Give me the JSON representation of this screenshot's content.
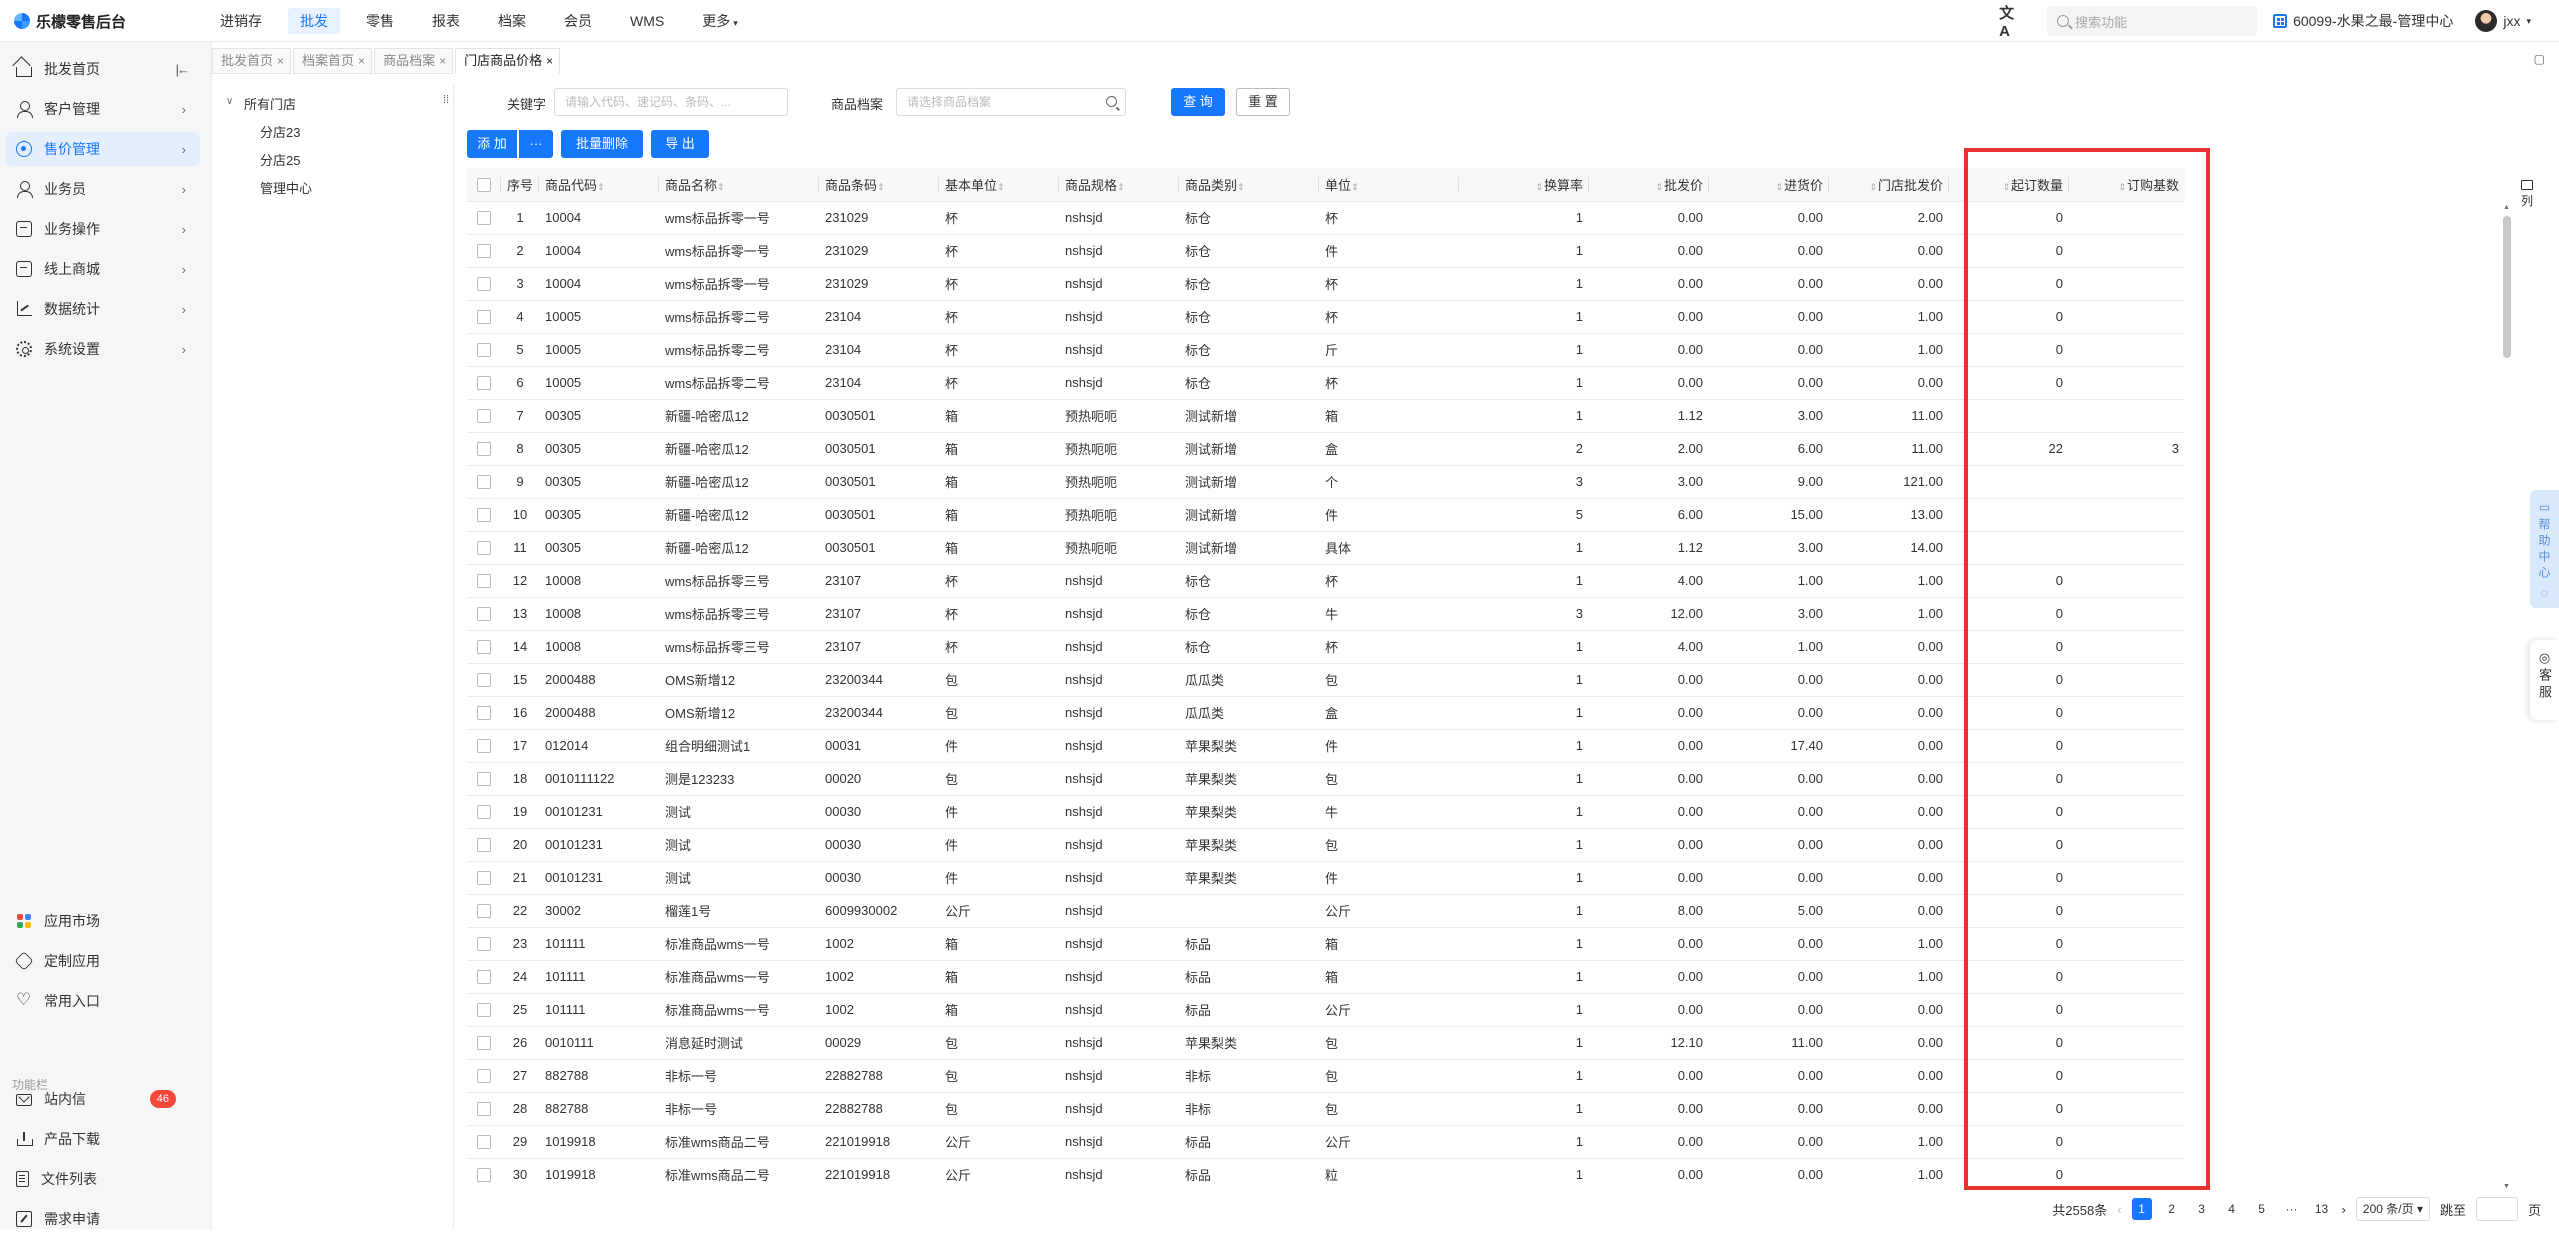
{
  "app": {
    "title": "乐檬零售后台"
  },
  "topnav": {
    "items": [
      {
        "label": "进销存"
      },
      {
        "label": "批发"
      },
      {
        "label": "零售"
      },
      {
        "label": "报表"
      },
      {
        "label": "档案"
      },
      {
        "label": "会员"
      },
      {
        "label": "WMS"
      },
      {
        "label": "更多"
      }
    ],
    "active": "批发",
    "search_placeholder": "搜索功能",
    "store": "60099-水果之最-管理中心",
    "user": "jxx"
  },
  "sidebar": {
    "items": [
      {
        "label": "批发首页",
        "icon": "home-icon"
      },
      {
        "label": "客户管理",
        "icon": "user-icon"
      },
      {
        "label": "售价管理",
        "icon": "price-icon"
      },
      {
        "label": "业务员",
        "icon": "salesman-icon"
      },
      {
        "label": "业务操作",
        "icon": "operation-icon"
      },
      {
        "label": "线上商城",
        "icon": "mall-icon"
      },
      {
        "label": "数据统计",
        "icon": "chart-icon"
      },
      {
        "label": "系统设置",
        "icon": "gear-icon"
      }
    ],
    "bottom": [
      {
        "label": "应用市场",
        "icon": "app-market-icon"
      },
      {
        "label": "定制应用",
        "icon": "custom-app-icon"
      },
      {
        "label": "常用入口",
        "icon": "heart-icon"
      }
    ],
    "section_title": "功能栏",
    "tools": [
      {
        "label": "站内信",
        "icon": "mail-icon",
        "badge": "46"
      },
      {
        "label": "产品下载",
        "icon": "download-icon"
      },
      {
        "label": "文件列表",
        "icon": "file-list-icon"
      },
      {
        "label": "需求申请",
        "icon": "request-icon"
      }
    ],
    "collapse_glyph": "|←"
  },
  "tabs": [
    {
      "label": "批发首页"
    },
    {
      "label": "档案首页"
    },
    {
      "label": "商品档案"
    },
    {
      "label": "门店商品价格"
    }
  ],
  "tree": {
    "root": "所有门店",
    "children": [
      "分店23",
      "分店25",
      "管理中心"
    ]
  },
  "filters": {
    "keyword_label": "关键字",
    "keyword_placeholder": "请输入代码、速记码、条码、...",
    "product_label": "商品档案",
    "product_placeholder": "请选择商品档案",
    "query_label": "查 询",
    "reset_label": "重 置"
  },
  "actions": {
    "add_label": "添 加",
    "more_label": "···",
    "batch_delete_label": "批量删除",
    "export_label": "导 出"
  },
  "table": {
    "columns": [
      "序号",
      "商品代码",
      "商品名称",
      "商品条码",
      "基本单位",
      "商品规格",
      "商品类别",
      "单位",
      "换算率",
      "批发价",
      "进货价",
      "门店批发价",
      "起订数量",
      "订购基数"
    ],
    "rows": [
      [
        "1",
        "10004",
        "wms标品拆零一号",
        "231029",
        "杯",
        "nshsjd",
        "标仓",
        "杯",
        "1",
        "0.00",
        "0.00",
        "2.00",
        "0",
        ""
      ],
      [
        "2",
        "10004",
        "wms标品拆零一号",
        "231029",
        "杯",
        "nshsjd",
        "标仓",
        "件",
        "1",
        "0.00",
        "0.00",
        "0.00",
        "0",
        ""
      ],
      [
        "3",
        "10004",
        "wms标品拆零一号",
        "231029",
        "杯",
        "nshsjd",
        "标仓",
        "杯",
        "1",
        "0.00",
        "0.00",
        "0.00",
        "0",
        ""
      ],
      [
        "4",
        "10005",
        "wms标品拆零二号",
        "23104",
        "杯",
        "nshsjd",
        "标仓",
        "杯",
        "1",
        "0.00",
        "0.00",
        "1.00",
        "0",
        ""
      ],
      [
        "5",
        "10005",
        "wms标品拆零二号",
        "23104",
        "杯",
        "nshsjd",
        "标仓",
        "斤",
        "1",
        "0.00",
        "0.00",
        "1.00",
        "0",
        ""
      ],
      [
        "6",
        "10005",
        "wms标品拆零二号",
        "23104",
        "杯",
        "nshsjd",
        "标仓",
        "杯",
        "1",
        "0.00",
        "0.00",
        "0.00",
        "0",
        ""
      ],
      [
        "7",
        "00305",
        "新疆-哈密瓜12",
        "0030501",
        "箱",
        "预热呃呃",
        "测试新增",
        "箱",
        "1",
        "1.12",
        "3.00",
        "11.00",
        "",
        ""
      ],
      [
        "8",
        "00305",
        "新疆-哈密瓜12",
        "0030501",
        "箱",
        "预热呃呃",
        "测试新增",
        "盒",
        "2",
        "2.00",
        "6.00",
        "11.00",
        "22",
        "3"
      ],
      [
        "9",
        "00305",
        "新疆-哈密瓜12",
        "0030501",
        "箱",
        "预热呃呃",
        "测试新增",
        "个",
        "3",
        "3.00",
        "9.00",
        "121.00",
        "",
        ""
      ],
      [
        "10",
        "00305",
        "新疆-哈密瓜12",
        "0030501",
        "箱",
        "预热呃呃",
        "测试新增",
        "件",
        "5",
        "6.00",
        "15.00",
        "13.00",
        "",
        ""
      ],
      [
        "11",
        "00305",
        "新疆-哈密瓜12",
        "0030501",
        "箱",
        "预热呃呃",
        "测试新增",
        "具体",
        "1",
        "1.12",
        "3.00",
        "14.00",
        "",
        ""
      ],
      [
        "12",
        "10008",
        "wms标品拆零三号",
        "23107",
        "杯",
        "nshsjd",
        "标仓",
        "杯",
        "1",
        "4.00",
        "1.00",
        "1.00",
        "0",
        ""
      ],
      [
        "13",
        "10008",
        "wms标品拆零三号",
        "23107",
        "杯",
        "nshsjd",
        "标仓",
        "牛",
        "3",
        "12.00",
        "3.00",
        "1.00",
        "0",
        ""
      ],
      [
        "14",
        "10008",
        "wms标品拆零三号",
        "23107",
        "杯",
        "nshsjd",
        "标仓",
        "杯",
        "1",
        "4.00",
        "1.00",
        "0.00",
        "0",
        ""
      ],
      [
        "15",
        "2000488",
        "OMS新增12",
        "23200344",
        "包",
        "nshsjd",
        "瓜瓜类",
        "包",
        "1",
        "0.00",
        "0.00",
        "0.00",
        "0",
        ""
      ],
      [
        "16",
        "2000488",
        "OMS新增12",
        "23200344",
        "包",
        "nshsjd",
        "瓜瓜类",
        "盒",
        "1",
        "0.00",
        "0.00",
        "0.00",
        "0",
        ""
      ],
      [
        "17",
        "012014",
        "组合明细测试1",
        "00031",
        "件",
        "nshsjd",
        "苹果梨类",
        "件",
        "1",
        "0.00",
        "17.40",
        "0.00",
        "0",
        ""
      ],
      [
        "18",
        "0010111122",
        "测是123233",
        "00020",
        "包",
        "nshsjd",
        "苹果梨类",
        "包",
        "1",
        "0.00",
        "0.00",
        "0.00",
        "0",
        ""
      ],
      [
        "19",
        "00101231",
        "测试",
        "00030",
        "件",
        "nshsjd",
        "苹果梨类",
        "牛",
        "1",
        "0.00",
        "0.00",
        "0.00",
        "0",
        ""
      ],
      [
        "20",
        "00101231",
        "测试",
        "00030",
        "件",
        "nshsjd",
        "苹果梨类",
        "包",
        "1",
        "0.00",
        "0.00",
        "0.00",
        "0",
        ""
      ],
      [
        "21",
        "00101231",
        "测试",
        "00030",
        "件",
        "nshsjd",
        "苹果梨类",
        "件",
        "1",
        "0.00",
        "0.00",
        "0.00",
        "0",
        ""
      ],
      [
        "22",
        "30002",
        "榴莲1号",
        "6009930002",
        "公斤",
        "nshsjd",
        "",
        "公斤",
        "1",
        "8.00",
        "5.00",
        "0.00",
        "0",
        ""
      ],
      [
        "23",
        "101111",
        "标准商品wms一号",
        "1002",
        "箱",
        "nshsjd",
        "标品",
        "箱",
        "1",
        "0.00",
        "0.00",
        "1.00",
        "0",
        ""
      ],
      [
        "24",
        "101111",
        "标准商品wms一号",
        "1002",
        "箱",
        "nshsjd",
        "标品",
        "箱",
        "1",
        "0.00",
        "0.00",
        "1.00",
        "0",
        ""
      ],
      [
        "25",
        "101111",
        "标准商品wms一号",
        "1002",
        "箱",
        "nshsjd",
        "标品",
        "公斤",
        "1",
        "0.00",
        "0.00",
        "0.00",
        "0",
        ""
      ],
      [
        "26",
        "0010111",
        "消息延时测试",
        "00029",
        "包",
        "nshsjd",
        "苹果梨类",
        "包",
        "1",
        "12.10",
        "11.00",
        "0.00",
        "0",
        ""
      ],
      [
        "27",
        "882788",
        "非标一号",
        "22882788",
        "包",
        "nshsjd",
        "非标",
        "包",
        "1",
        "0.00",
        "0.00",
        "0.00",
        "0",
        ""
      ],
      [
        "28",
        "882788",
        "非标一号",
        "22882788",
        "包",
        "nshsjd",
        "非标",
        "包",
        "1",
        "0.00",
        "0.00",
        "0.00",
        "0",
        ""
      ],
      [
        "29",
        "1019918",
        "标准wms商品二号",
        "221019918",
        "公斤",
        "nshsjd",
        "标品",
        "公斤",
        "1",
        "0.00",
        "0.00",
        "1.00",
        "0",
        ""
      ],
      [
        "30",
        "1019918",
        "标准wms商品二号",
        "221019918",
        "公斤",
        "nshsjd",
        "标品",
        "粒",
        "1",
        "0.00",
        "0.00",
        "1.00",
        "0",
        ""
      ]
    ]
  },
  "column_tool_label": "列",
  "help": {
    "label": "帮助中心",
    "service_label": "客服"
  },
  "pager": {
    "total": "共2558条",
    "pages": [
      "1",
      "2",
      "3",
      "4",
      "5",
      "···",
      "13"
    ],
    "current": "1",
    "size": "200 条/页",
    "jump_label": "跳至",
    "page_suffix": "页"
  },
  "colors": {
    "accent": "#1677ff",
    "highlight": "#e8312c",
    "badge": "#f5483b"
  }
}
